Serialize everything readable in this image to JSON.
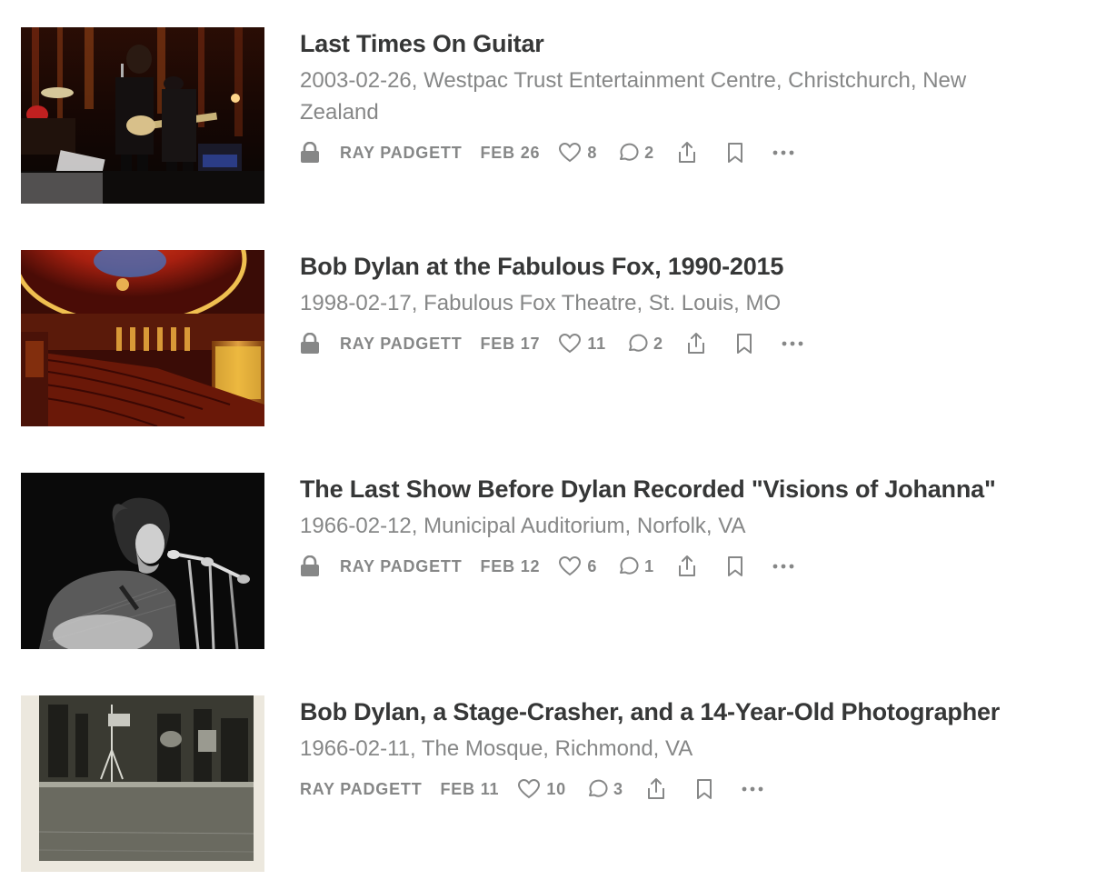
{
  "colors": {
    "title": "#363737",
    "muted": "#868787",
    "background": "#ffffff"
  },
  "icons": {
    "lock": "lock-icon",
    "like": "heart-icon",
    "comment": "comment-icon",
    "share": "share-icon",
    "bookmark": "bookmark-icon",
    "more": "more-icon"
  },
  "posts": [
    {
      "title": "Last Times On Guitar",
      "subtitle": "2003-02-26, Westpac Trust Entertainment Centre, Christchurch, New Zealand",
      "locked": true,
      "author": "RAY PADGETT",
      "date": "FEB 26",
      "likes": "8",
      "comments": "2",
      "thumbnail": "concert-stage-photo"
    },
    {
      "title": "Bob Dylan at the Fabulous Fox, 1990-2015",
      "subtitle": "1998-02-17, Fabulous Fox Theatre, St. Louis, MO",
      "locked": true,
      "author": "RAY PADGETT",
      "date": "FEB 17",
      "likes": "11",
      "comments": "2",
      "thumbnail": "theatre-interior-photo"
    },
    {
      "title": "The Last Show Before Dylan Recorded \"Visions of Johanna\"",
      "subtitle": "1966-02-12, Municipal Auditorium, Norfolk, VA",
      "locked": true,
      "author": "RAY PADGETT",
      "date": "FEB 12",
      "likes": "6",
      "comments": "1",
      "thumbnail": "bw-singer-photo"
    },
    {
      "title": "Bob Dylan, a Stage-Crasher, and a 14-Year-Old Photographer",
      "subtitle": "1966-02-11, The Mosque, Richmond, VA",
      "locked": false,
      "author": "RAY PADGETT",
      "date": "FEB 11",
      "likes": "10",
      "comments": "3",
      "thumbnail": "vintage-stage-photo"
    }
  ]
}
